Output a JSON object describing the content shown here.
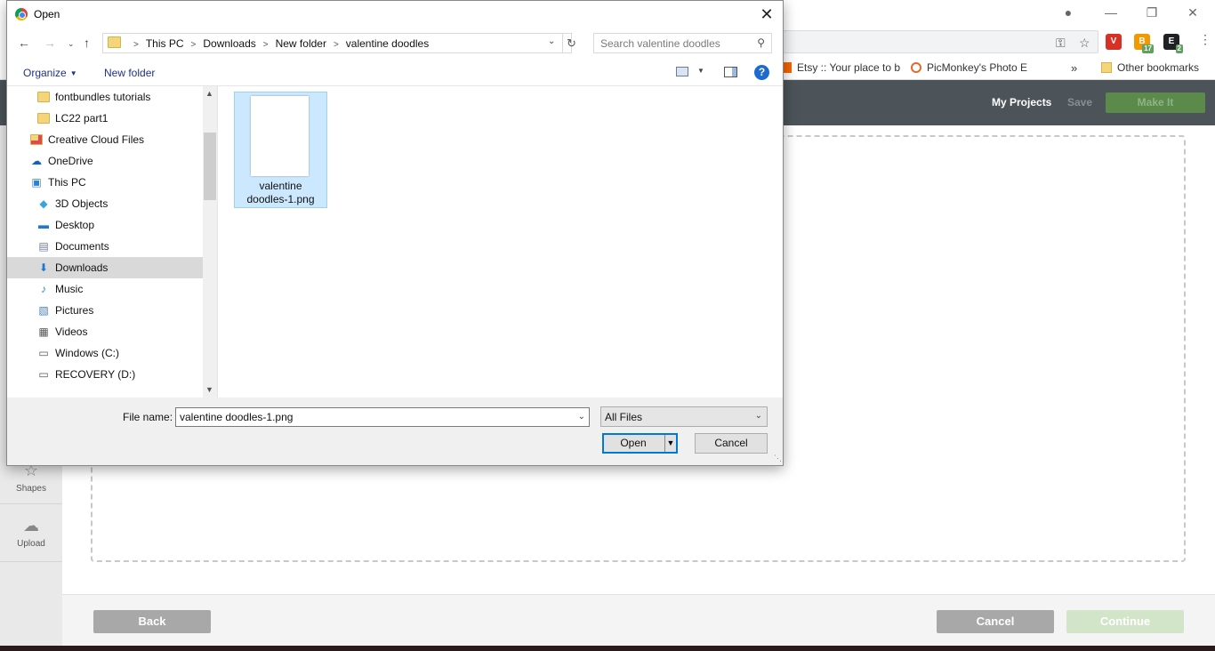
{
  "browser": {
    "bookmarks": [
      {
        "label": "Etsy :: Your place to b"
      },
      {
        "label": "PicMonkey's Photo E"
      },
      {
        "label": "Other bookmarks"
      }
    ],
    "overflow_glyph": "»",
    "extensions": [
      {
        "label": "V",
        "color": "#d93025"
      },
      {
        "label": "B",
        "color": "#f29900",
        "badge": "17"
      },
      {
        "label": "E",
        "color": "#202124",
        "badge": "2"
      }
    ]
  },
  "app": {
    "header": {
      "my_projects": "My Projects",
      "save": "Save",
      "make_it": "Make It"
    },
    "rail": [
      {
        "label": "Shapes",
        "icon": "shapes-icon"
      },
      {
        "label": "Upload",
        "icon": "upload-cloud-icon"
      }
    ],
    "footer": {
      "back": "Back",
      "cancel": "Cancel",
      "continue": "Continue"
    }
  },
  "dialog": {
    "title": "Open",
    "breadcrumbs": [
      "This PC",
      "Downloads",
      "New folder",
      "valentine doodles"
    ],
    "search_placeholder": "Search valentine doodles",
    "commands": {
      "organize": "Organize",
      "new_folder": "New folder"
    },
    "nav_tree": [
      {
        "label": "fontbundles tutorials",
        "icon": "folder-icon",
        "indent": 2
      },
      {
        "label": "LC22 part1",
        "icon": "folder-icon",
        "indent": 2
      },
      {
        "label": "Creative Cloud Files",
        "icon": "creative-cloud-folder-icon",
        "indent": 1
      },
      {
        "label": "OneDrive",
        "icon": "onedrive-icon",
        "indent": 1
      },
      {
        "label": "This PC",
        "icon": "computer-icon",
        "indent": 1
      },
      {
        "label": "3D Objects",
        "icon": "3d-objects-icon",
        "indent": 2
      },
      {
        "label": "Desktop",
        "icon": "desktop-icon",
        "indent": 2
      },
      {
        "label": "Documents",
        "icon": "documents-icon",
        "indent": 2
      },
      {
        "label": "Downloads",
        "icon": "downloads-icon",
        "indent": 2,
        "selected": true
      },
      {
        "label": "Music",
        "icon": "music-icon",
        "indent": 2
      },
      {
        "label": "Pictures",
        "icon": "pictures-icon",
        "indent": 2
      },
      {
        "label": "Videos",
        "icon": "videos-icon",
        "indent": 2
      },
      {
        "label": "Windows (C:)",
        "icon": "drive-icon",
        "indent": 2
      },
      {
        "label": "RECOVERY (D:)",
        "icon": "drive-icon",
        "indent": 2
      }
    ],
    "files": [
      {
        "name_line1": "valentine",
        "name_line2": "doodles-1.png",
        "selected": true
      }
    ],
    "file_name_label": "File name:",
    "file_name_value": "valentine doodles-1.png",
    "file_type": "All Files",
    "buttons": {
      "open": "Open",
      "cancel": "Cancel"
    }
  },
  "colors": {
    "accent": "#0078d7",
    "selection": "#cce8ff",
    "app_header": "#4c5459",
    "make_it": "#5b8a4b",
    "continue": "#d3e5c8"
  }
}
